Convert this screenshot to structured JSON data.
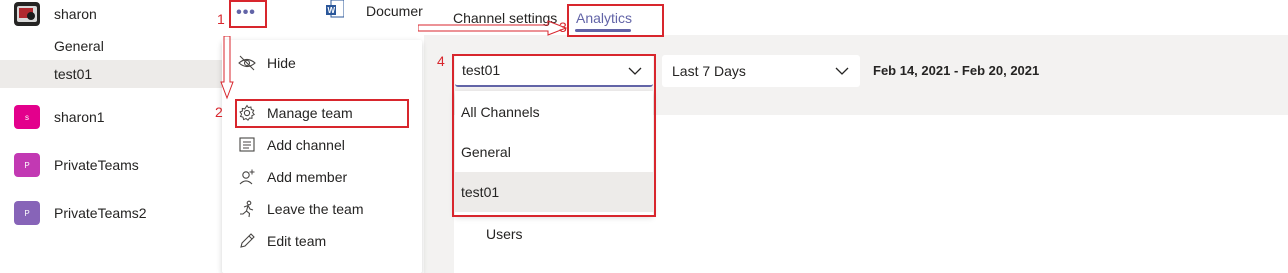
{
  "sidebar": {
    "teams": [
      {
        "name": "sharon",
        "initial": "",
        "color": "#252423"
      },
      {
        "name": "sharon1",
        "initial": "s",
        "color": "#e3008c"
      },
      {
        "name": "PrivateTeams",
        "initial": "P",
        "color": "#c239b3"
      },
      {
        "name": "PrivateTeams2",
        "initial": "P",
        "color": "#8764b8"
      }
    ],
    "channels": [
      {
        "name": "General",
        "selected": false
      },
      {
        "name": "test01",
        "selected": true
      }
    ],
    "more_options_glyph": "•••"
  },
  "context_menu": {
    "items": [
      {
        "label": "Hide",
        "icon": "hide-icon"
      },
      {
        "label": "Manage team",
        "icon": "gear-icon"
      },
      {
        "label": "Add channel",
        "icon": "add-channel-icon"
      },
      {
        "label": "Add member",
        "icon": "add-member-icon"
      },
      {
        "label": "Leave the team",
        "icon": "leave-team-icon"
      },
      {
        "label": "Edit team",
        "icon": "pencil-icon"
      }
    ]
  },
  "tabs": {
    "documents": "Documer",
    "channel_settings": "Channel settings",
    "analytics": "Analytics"
  },
  "analytics": {
    "channel_filter": {
      "value": "test01",
      "options": [
        "All Channels",
        "General",
        "test01"
      ],
      "selected_index": 2
    },
    "period_filter": {
      "value": "Last 7 Days"
    },
    "date_range_start": "Feb 14, 2021",
    "date_range_separator": "-",
    "date_range_end": "Feb 20, 2021",
    "users_label": "Users"
  },
  "annotations": {
    "step1": "1",
    "step2": "2",
    "step3": "3",
    "step4": "4"
  },
  "colors": {
    "accent": "#6264a7",
    "annotation_red": "#d8262d",
    "panel_gray": "#f3f2f1",
    "selected_gray": "#edebe9"
  }
}
